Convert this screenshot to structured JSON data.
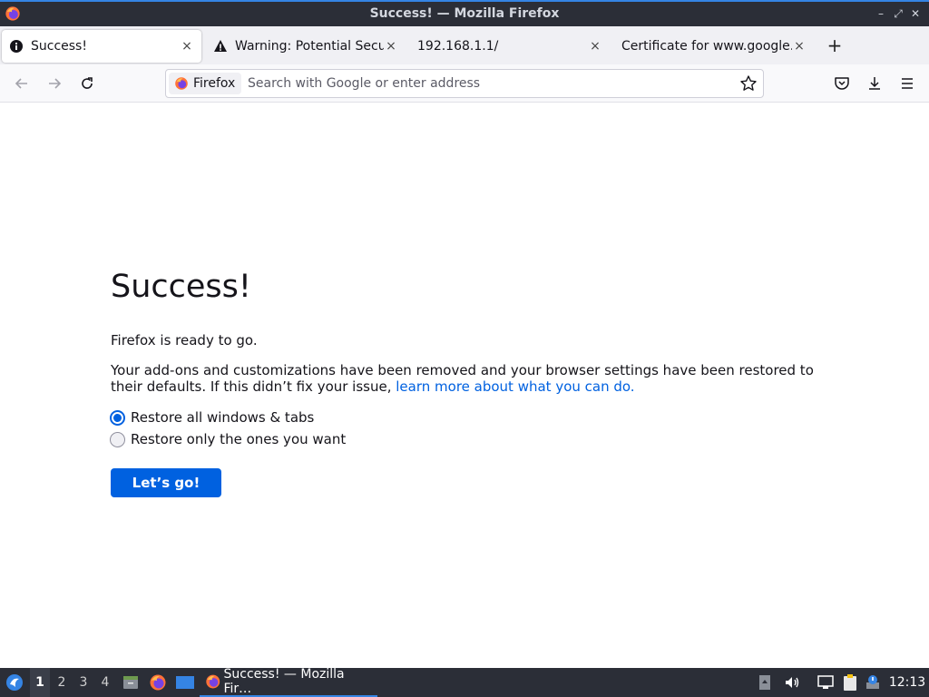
{
  "window": {
    "title": "Success! — Mozilla Firefox",
    "controls": {
      "minimize": "–",
      "maximize": "⤢",
      "close": "✕"
    }
  },
  "tabs": [
    {
      "label": "Success!",
      "icon": "info-icon",
      "active": true
    },
    {
      "label": "Warning: Potential Security Risk Ahead",
      "icon": "warning-icon",
      "active": false
    },
    {
      "label": "192.168.1.1/",
      "icon": "none",
      "active": false
    },
    {
      "label": "Certificate for www.google.com",
      "icon": "none",
      "active": false
    }
  ],
  "tab_close_glyph": "×",
  "new_tab_glyph": "+",
  "navbar": {
    "identity_label": "Firefox",
    "url_placeholder": "Search with Google or enter address",
    "url_value": ""
  },
  "page": {
    "title": "Success!",
    "ready_text": "Firefox is ready to go.",
    "description": "Your add-ons and customizations have been removed and your browser settings have been restored to their defaults. If this didn’t fix your issue, ",
    "link_text": "learn more about what you can do.",
    "options": [
      {
        "label": "Restore all windows & tabs",
        "checked": true
      },
      {
        "label": "Restore only the ones you want",
        "checked": false
      }
    ],
    "button_label": "Let’s go!"
  },
  "taskbar": {
    "workspaces": [
      "1",
      "2",
      "3",
      "4"
    ],
    "active_workspace": "1",
    "task_label": "Success! — Mozilla Fir…",
    "clock": "12:13"
  },
  "colors": {
    "accent": "#0061e0",
    "titlebar": "#2b2e37",
    "tabstrip": "#f0f0f4"
  }
}
